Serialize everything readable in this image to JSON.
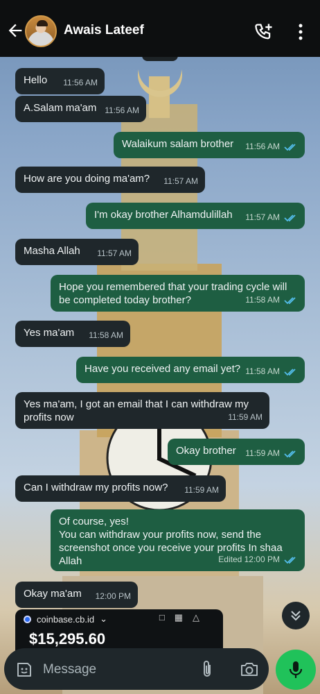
{
  "header": {
    "contact_name": "Awais Lateef"
  },
  "icons": {
    "back": "back-arrow-icon",
    "call_add": "add-call-icon",
    "menu": "vertical-dots-icon",
    "read": "double-check-icon",
    "scroll_down": "double-chevron-down-icon",
    "sticker": "sticker-icon",
    "attach": "paperclip-icon",
    "camera": "camera-icon",
    "mic": "microphone-icon"
  },
  "colors": {
    "header_bg": "#0d0f10",
    "incoming_bubble": "#1f272b",
    "outgoing_bubble": "#1e5e42",
    "read_tick": "#53bdeb",
    "mic_button": "#20c25a"
  },
  "messages": [
    {
      "direction": "in",
      "text": "Hello",
      "time": "11:56 AM"
    },
    {
      "direction": "in",
      "text": "A.Salam ma'am",
      "time": "11:56 AM"
    },
    {
      "direction": "out",
      "text": "Walaikum salam brother",
      "time": "11:56 AM"
    },
    {
      "direction": "in",
      "text": "How are you doing ma'am?",
      "time": "11:57 AM"
    },
    {
      "direction": "out",
      "text": "I'm okay brother Alhamdulillah",
      "time": "11:57 AM"
    },
    {
      "direction": "in",
      "text": "Masha Allah",
      "time": "11:57 AM"
    },
    {
      "direction": "out",
      "text": "Hope you remembered that your trading cycle will be completed today brother?",
      "time": "11:58 AM"
    },
    {
      "direction": "in",
      "text": "Yes ma'am",
      "time": "11:58 AM"
    },
    {
      "direction": "out",
      "text": "Have you received any email yet?",
      "time": "11:58 AM"
    },
    {
      "direction": "in",
      "text": "Yes ma'am, I got an email that I can withdraw my profits now",
      "time": "11:59 AM"
    },
    {
      "direction": "out",
      "text": "Okay brother",
      "time": "11:59 AM"
    },
    {
      "direction": "in",
      "text": "Can I withdraw my profits now?",
      "time": "11:59 AM"
    },
    {
      "direction": "out",
      "text": "Of course, yes!\nYou can withdraw your profits now, send the screenshot once you receive your profits In shaa Allah",
      "time": "Edited 12:00 PM"
    },
    {
      "direction": "in",
      "text": "Okay ma'am",
      "time": "12:00 PM"
    }
  ],
  "image_preview": {
    "site": "coinbase.cb.id",
    "amount": "$15,295.60"
  },
  "composer": {
    "placeholder": "Message"
  }
}
